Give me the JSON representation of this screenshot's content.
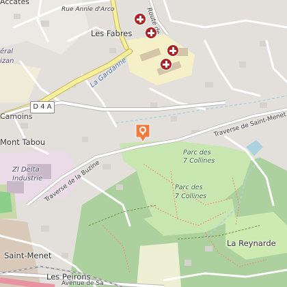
{
  "map": {
    "labels": {
      "acates": "Accates",
      "rue_annie": "Rue Annie d'Arco",
      "route_de": "Route de",
      "les_fabres": "Les Fabres",
      "general": "éral",
      "bizan": "izan",
      "la_gardanne": "La Gardanne",
      "camoins": "Camoins",
      "d4a": "D 4 A",
      "mont_tabou": "Mont Tabou",
      "traverse_st_menet": "Traverse de Saint-Menet",
      "traverse_buzine": "Traverse de la Buzine",
      "zi_delta_1": "ZI Delta",
      "zi_delta_2": "Industrie",
      "parc_7_collines_a1": "Parc des",
      "parc_7_collines_a2": "7 Collines",
      "parc_7_collines_b1": "Parc des",
      "parc_7_collines_b2": "7 Collines",
      "la_reynarde": "La Reynarde",
      "saint_menet": "Saint-Menet",
      "les_peirons": "Les Peirons",
      "avenue_de_sa": "Avenue de Sa"
    },
    "icons": {
      "hospital": "hospital-cross-icon",
      "marker": "location-marker-icon"
    },
    "colors": {
      "marker": "#f07b3f",
      "hospital": "#b02020",
      "park_green": "#c8e6b0",
      "forest": "#add19e",
      "industrial": "#ebdbe8",
      "highway": "#f6f09c",
      "water": "#aad3df"
    }
  }
}
